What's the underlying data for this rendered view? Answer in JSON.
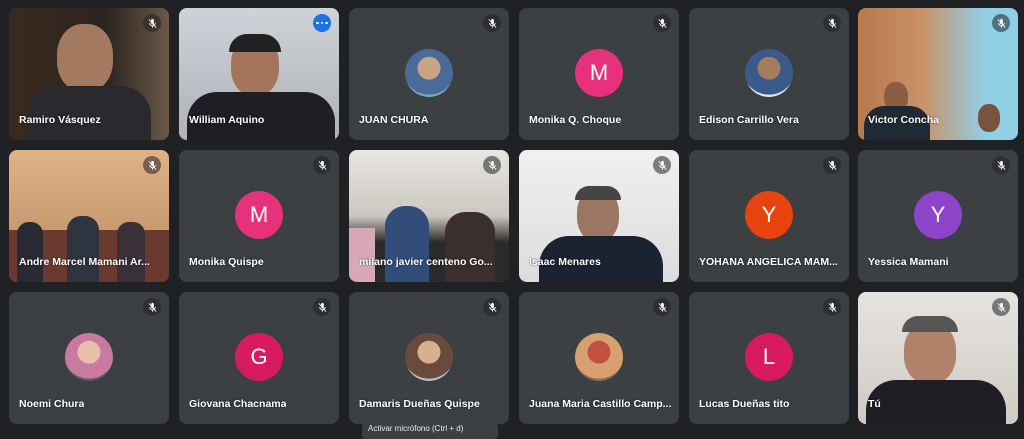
{
  "participants": [
    {
      "name": "Ramiro Vásquez",
      "kind": "video",
      "muted": true
    },
    {
      "name": "William Aquino",
      "kind": "video",
      "muted": false,
      "menu_icon": "more-options-icon"
    },
    {
      "name": "JUAN CHURA",
      "kind": "photo-avatar",
      "muted": true
    },
    {
      "name": "Monika Q. Choque",
      "kind": "letter",
      "letter": "M",
      "color": "#e8317c",
      "muted": true
    },
    {
      "name": "Edison Carrillo Vera",
      "kind": "photo-avatar",
      "muted": true
    },
    {
      "name": "Victor Concha",
      "kind": "video",
      "muted": true
    },
    {
      "name": "Andre Marcel Mamani Ar...",
      "kind": "video",
      "muted": true
    },
    {
      "name": "Monika Quispe",
      "kind": "letter",
      "letter": "M",
      "color": "#e8317c",
      "muted": true
    },
    {
      "name": "milano javier centeno Go...",
      "kind": "video",
      "muted": true
    },
    {
      "name": "Isaac Menares",
      "kind": "video",
      "muted": true
    },
    {
      "name": "YOHANA ANGELICA MAM...",
      "kind": "letter",
      "letter": "Y",
      "color": "#e8430f",
      "muted": true
    },
    {
      "name": "Yessica Mamani",
      "kind": "letter",
      "letter": "Y",
      "color": "#8e44c9",
      "muted": true
    },
    {
      "name": "Noemi Chura",
      "kind": "photo-avatar",
      "muted": true
    },
    {
      "name": "Giovana Chacnama",
      "kind": "letter",
      "letter": "G",
      "color": "#d81b60",
      "muted": true
    },
    {
      "name": "Damaris Dueñas Quispe",
      "kind": "photo-avatar",
      "muted": true
    },
    {
      "name": "Juana Maria Castillo Camp...",
      "kind": "photo-avatar",
      "muted": true
    },
    {
      "name": "Lucas Dueñas tito",
      "kind": "letter",
      "letter": "L",
      "color": "#d81b60",
      "muted": true
    },
    {
      "name": "Tú",
      "kind": "video",
      "muted": true
    }
  ],
  "toast": "Activar micrófono (Ctrl + d)"
}
